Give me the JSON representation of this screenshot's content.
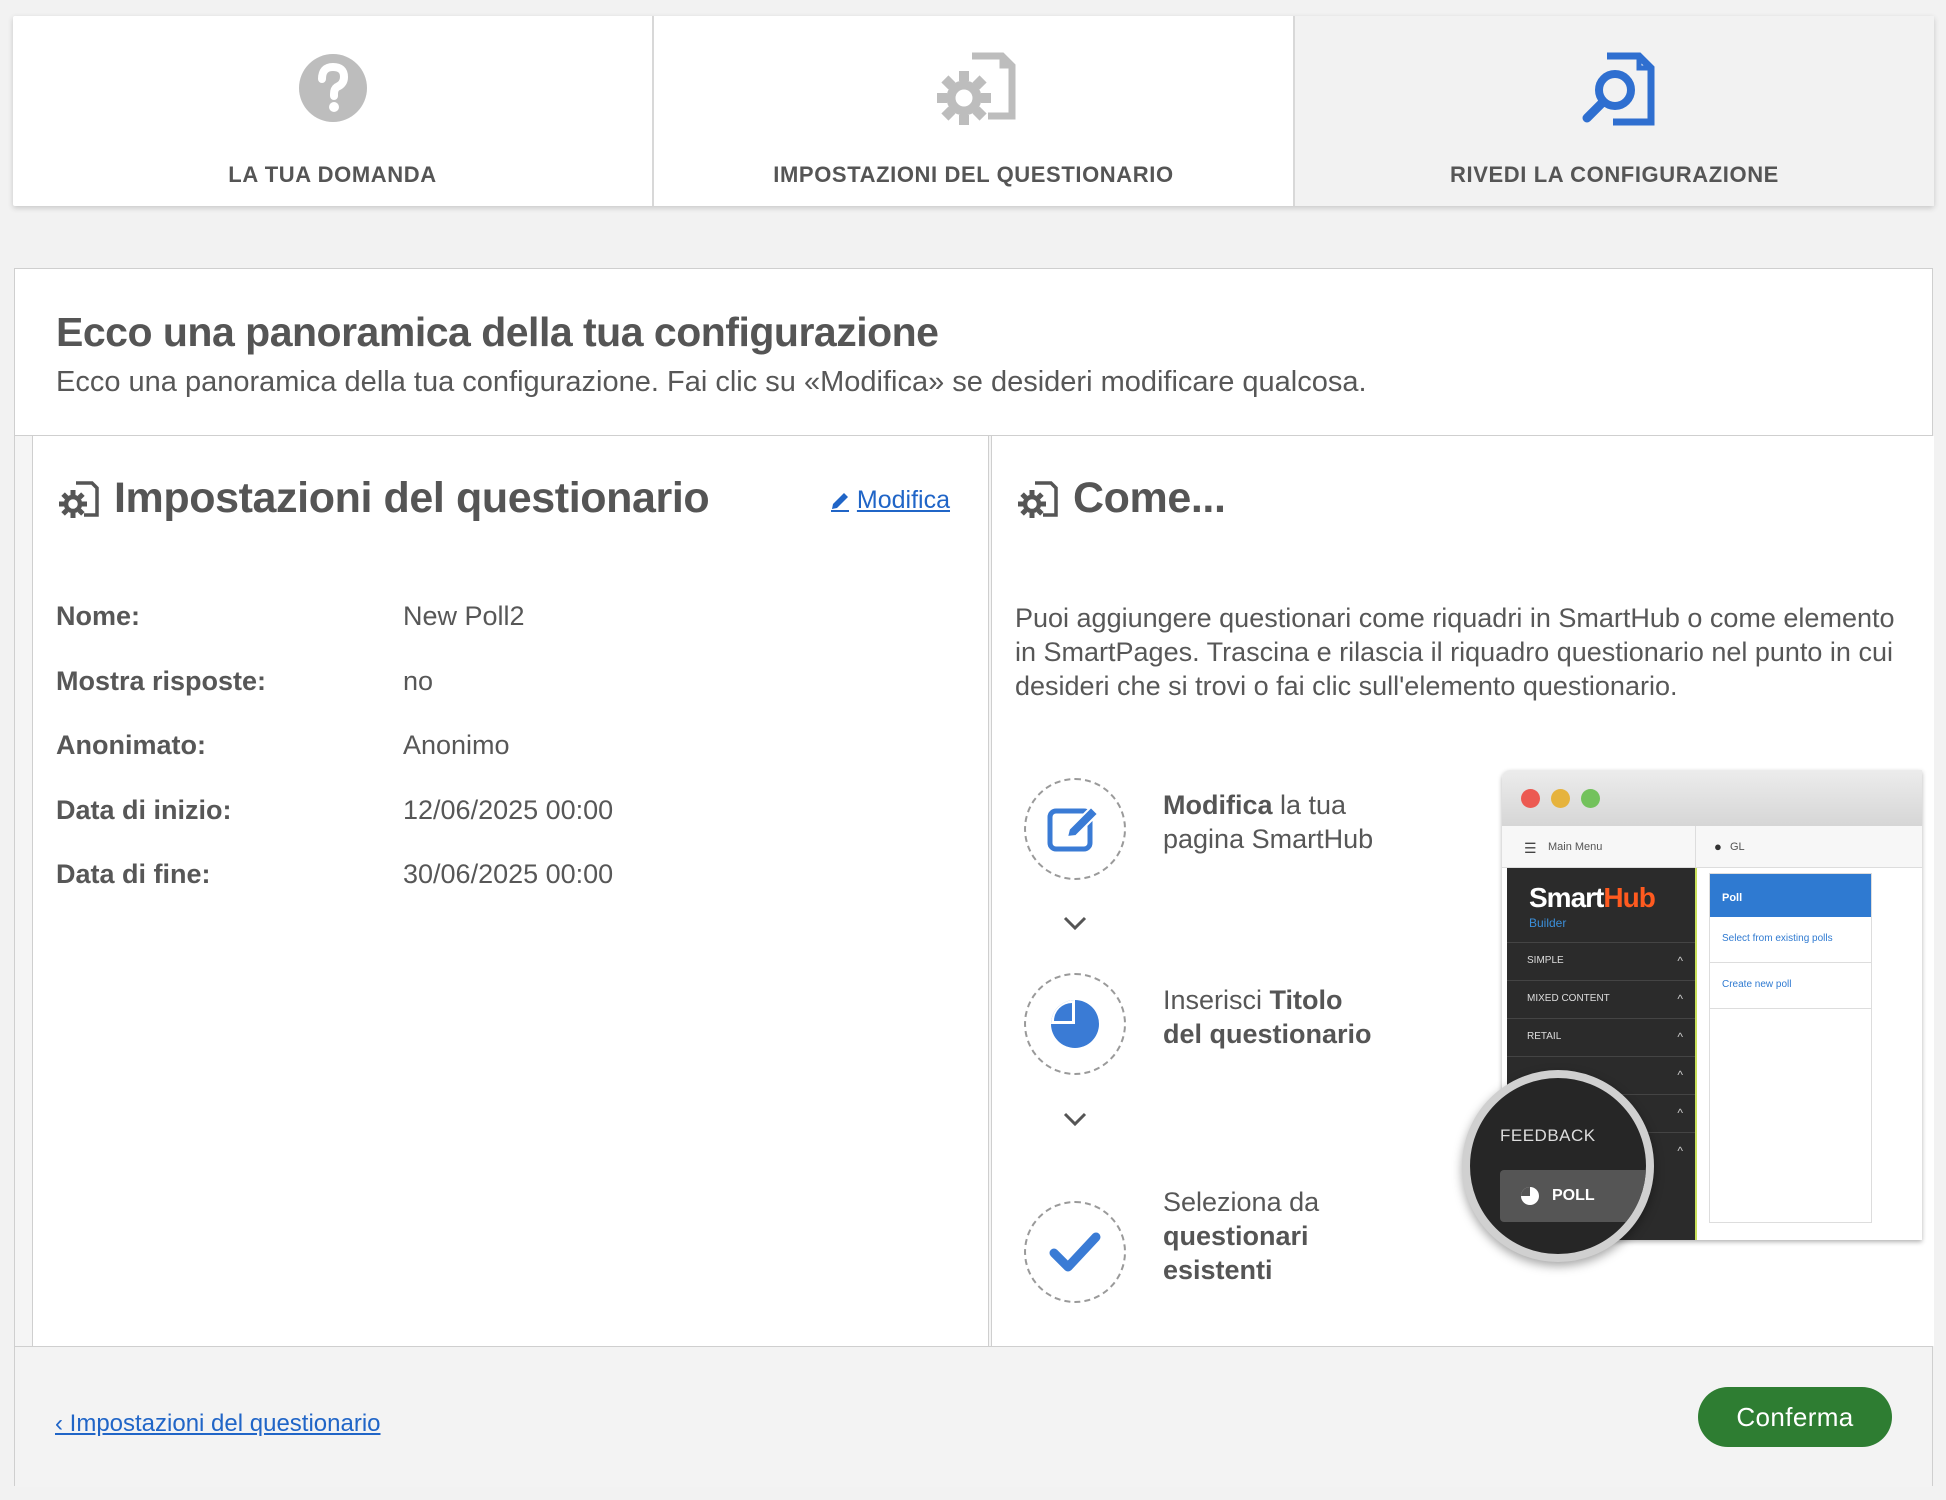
{
  "stepper": {
    "steps": [
      {
        "label": "LA TUA DOMANDA",
        "icon": "question-icon"
      },
      {
        "label": "IMPOSTAZIONI DEL QUESTIONARIO",
        "icon": "settings-document-icon"
      },
      {
        "label": "RIVEDI LA CONFIGURAZIONE",
        "icon": "review-document-icon",
        "active": true
      }
    ]
  },
  "header": {
    "title": "Ecco una panoramica della tua configurazione",
    "subtitle": "Ecco una panoramica della tua configurazione. Fai clic su «Modifica» se desideri modificare qualcosa."
  },
  "settings_panel": {
    "title": "Impostazioni del questionario",
    "edit_label": "Modifica",
    "rows": [
      {
        "key": "Nome:",
        "value": "New Poll2"
      },
      {
        "key": "Mostra risposte:",
        "value": "no"
      },
      {
        "key": "Anonimato:",
        "value": "Anonimo"
      },
      {
        "key": "Data di inizio:",
        "value": "12/06/2025 00:00"
      },
      {
        "key": "Data di fine:",
        "value": "30/06/2025 00:00"
      }
    ]
  },
  "how_panel": {
    "title": "Come...",
    "description": "Puoi aggiungere questionari come riquadri in SmartHub o come elemento in SmartPages. Trascina e rilascia il riquadro questionario nel punto in cui desideri che si trovi o fai clic sull'elemento questionario.",
    "steps": [
      {
        "icon": "edit-icon",
        "bold1": "Modifica",
        "text1": " la tua",
        "line2": "pagina SmartHub"
      },
      {
        "icon": "pie-chart-icon",
        "text1": "Inserisci ",
        "bold1": "Titolo",
        "line2": "del questionario"
      },
      {
        "icon": "check-icon",
        "text1": "Seleziona da",
        "line2": "questionari",
        "line3": "esistenti"
      }
    ],
    "illustration": {
      "menu": "Main Menu",
      "lang": "GL",
      "logo_a": "Smart",
      "logo_b": "Hub",
      "logo_sub": "Builder",
      "sections": [
        "SIMPLE",
        "MIXED CONTENT",
        "RETAIL"
      ],
      "poll_title": "Poll",
      "link1": "Select from existing polls",
      "link2": "Create new poll",
      "feedback": "FEEDBACK",
      "poll_button": "POLL"
    }
  },
  "footer": {
    "back_label": "‹ Impostazioni del questionario",
    "confirm_label": "Conferma"
  },
  "colors": {
    "accent_blue": "#2065c7",
    "icon_blue": "#3a7bd5",
    "confirm_green": "#2e7d32"
  }
}
